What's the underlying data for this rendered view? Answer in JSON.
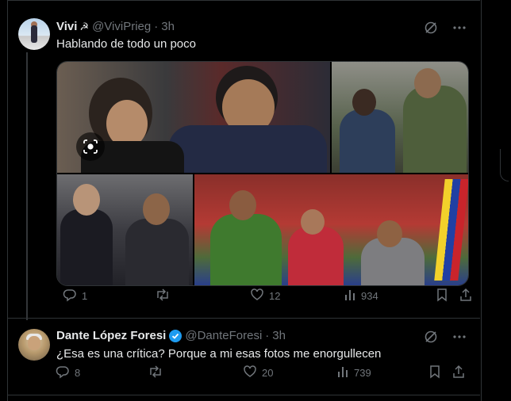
{
  "posts": [
    {
      "display_name": "Vivi",
      "name_emblem": "☭",
      "handle": "@ViviPrieg",
      "dot": "·",
      "time": "3h",
      "text": "Hablando de todo un poco",
      "stats": {
        "replies": "1",
        "retweets": "",
        "likes": "12",
        "views": "934"
      }
    },
    {
      "display_name": "Dante López Foresi",
      "handle": "@DanteForesi",
      "dot": "·",
      "time": "3h",
      "text": "¿Esa es una crítica? Porque a mi esas fotos me enorgullecen",
      "stats": {
        "replies": "8",
        "retweets": "",
        "likes": "20",
        "views": "739"
      }
    }
  ],
  "colors": {
    "background": "#000000",
    "text_primary": "#e7e9ea",
    "text_secondary": "#71767b",
    "border": "#2f3336",
    "verified_badge": "#1d9bf0"
  },
  "icons": [
    "grok-icon",
    "more-icon",
    "reply-icon",
    "retweet-icon",
    "like-icon",
    "views-icon",
    "bookmark-icon",
    "share-icon",
    "camera-icon",
    "verified-icon"
  ]
}
